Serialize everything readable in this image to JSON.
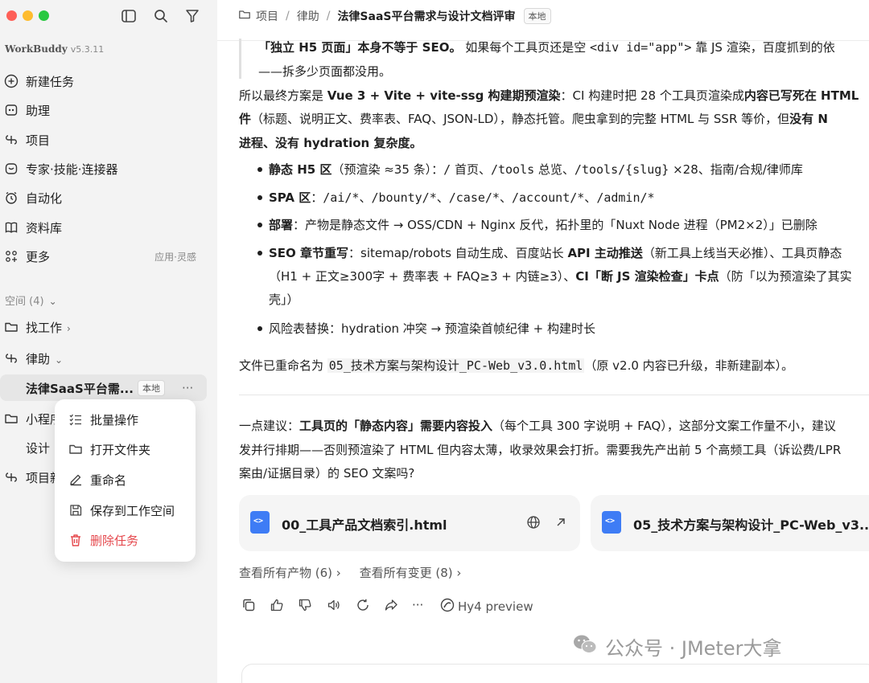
{
  "app": {
    "name": "WorkBuddy",
    "version": "v5.3.11"
  },
  "sidebar": {
    "nav": [
      {
        "label": "新建任务"
      },
      {
        "label": "助理"
      },
      {
        "label": "项目"
      },
      {
        "label": "专家·技能·连接器"
      },
      {
        "label": "自动化"
      },
      {
        "label": "资料库"
      },
      {
        "label": "更多",
        "aux": "应用·灵感"
      }
    ],
    "spaces_header": "空间 (4)",
    "spaces": [
      {
        "label": "找工作"
      },
      {
        "label": "律助"
      },
      {
        "label": "法律SaaS平台需...",
        "badge": "本地",
        "more": "···"
      },
      {
        "label": "小程序"
      },
      {
        "label": "设计"
      },
      {
        "label": "项目新"
      }
    ]
  },
  "context_menu": {
    "items": [
      {
        "label": "批量操作"
      },
      {
        "label": "打开文件夹"
      },
      {
        "label": "重命名"
      },
      {
        "label": "保存到工作空间"
      },
      {
        "label": "删除任务"
      }
    ],
    "danger_color": "#e5484d"
  },
  "breadcrumb": {
    "root": "项目",
    "sep": "/",
    "space": "律助",
    "current": "法律SaaS平台需求与设计文档评审",
    "badge": "本地"
  },
  "content": {
    "quote": {
      "l1_b": "「独立 H5 页面」本身不等于 SEO。",
      "l1_t": " 如果每个工具页还是空 ",
      "l1_c": "<div id=\"app\">",
      "l1_t2": " 靠 JS 渲染，百度抓到的依",
      "l2": "——拆多少页面都没用。"
    },
    "para1": {
      "a": "所以最终方案是 ",
      "b": "Vue 3 + Vite + vite-ssg 构建期预渲染",
      "c": "：CI 构建时把 28 个工具页渲染成",
      "d": "内容已写死在 HTML",
      "e": "件",
      "f": "（标题、说明正文、费率表、FAQ、JSON-LD），静态托管。爬虫拿到的完整 HTML 与 SSR 等价，但",
      "g": "没有 N",
      "h": "进程、没有 hydration 复杂度。"
    },
    "b1": {
      "b": "静态 H5 区",
      "t": "（预渲染 ≈35 条）：",
      "c1": "/",
      "t2": " 首页、",
      "c2": "/tools",
      "t3": " 总览、",
      "c3": "/tools/{slug}",
      "t4": " ×28、指南/合规/律师库"
    },
    "b2": {
      "b": "SPA 区",
      "t": "：",
      "c1": "/ai/*",
      "s": "、",
      "c2": "/bounty/*",
      "c3": "/case/*",
      "c4": "/account/*",
      "c5": "/admin/*"
    },
    "b3": {
      "b": "部署",
      "t": "：产物是静态文件 → OSS/CDN + Nginx 反代，拓扑里的「Nuxt Node 进程（PM2×2）」已删除"
    },
    "b4": {
      "b": "SEO 章节重写",
      "t": "：sitemap/robots 自动生成、百度站长 ",
      "b2": "API 主动推送",
      "t2": "（新工具上线当天必推）、工具页静态",
      "l2a": "（H1 + 正文≥300字 + 费率表 + FAQ≥3 + 内链≥3）、",
      "l2b": "CI「断 JS 渲染检查」卡点",
      "l2c": "（防「以为预渲染了其实",
      "l3": "壳」）"
    },
    "b5": {
      "t": "风险表替换：hydration 冲突 → 预渲染首帧纪律 + 构建时长"
    },
    "rename": {
      "a": "文件已重命名为 ",
      "c": "05_技术方案与架构设计_PC-Web_v3.0.html",
      "b": "（原 v2.0 内容已升级，非新建副本）。"
    },
    "advice": {
      "a": "一点建议：",
      "b": "工具页的「静态内容」需要内容投入",
      "c": "（每个工具 300 字说明 + FAQ），这部分文案工作量不小，建议",
      "l2": "发并行排期——否则预渲染了 HTML 但内容太薄，收录效果会打折。需要我先产出前 5 个高频工具（诉讼费/LPR",
      "l3": "案由/证据目录）的 SEO 文案吗?"
    }
  },
  "cards": [
    {
      "name": "00_工具产品文档索引.html",
      "icon": "code-file-icon"
    },
    {
      "name": "05_技术方案与架构设计_PC-Web_v3...",
      "icon": "code-file-icon"
    }
  ],
  "links": {
    "artifacts": "查看所有产物 (6)",
    "changes": "查看所有变更 (8)"
  },
  "model": "Hy4 preview",
  "more_dots": "···",
  "watermark": "公众号 · JMeter大拿",
  "colors": {
    "sidebar_bg": "#f3f3f3",
    "active_row": "#e6e6e6",
    "danger": "#e5484d",
    "file_icon": "#3e7cf5"
  }
}
